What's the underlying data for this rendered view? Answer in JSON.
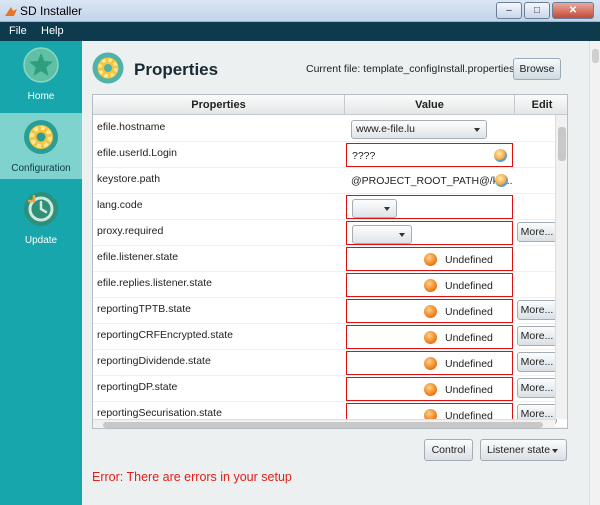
{
  "window": {
    "title": "SD Installer"
  },
  "menu": {
    "file": "File",
    "help": "Help"
  },
  "sidebar": {
    "items": [
      {
        "label": "Home",
        "icon": "star-icon",
        "active": false
      },
      {
        "label": "Configuration",
        "icon": "gear-icon",
        "active": true
      },
      {
        "label": "Update",
        "icon": "clock-refresh-icon",
        "active": false
      }
    ]
  },
  "header": {
    "title": "Properties",
    "current_file": "Current file: template_configInstall.properties",
    "browse_label": "Browse"
  },
  "table": {
    "columns": [
      "Properties",
      "Value",
      "Edit"
    ],
    "rows": [
      {
        "property": "efile.hostname",
        "value": "www.e-file.lu",
        "kind": "combo",
        "error": false,
        "edit": ""
      },
      {
        "property": "efile.userId.Login",
        "value": "????",
        "kind": "text",
        "error": true,
        "edit": ""
      },
      {
        "property": "keystore.path",
        "value": "@PROJECT_ROOT_PATH@/ke...",
        "kind": "text",
        "error": false,
        "edit": ""
      },
      {
        "property": "lang.code",
        "value": "",
        "kind": "combo",
        "error": true,
        "edit": ""
      },
      {
        "property": "proxy.required",
        "value": "",
        "kind": "combo",
        "error": true,
        "edit": "More..."
      },
      {
        "property": "efile.listener.state",
        "value": "Undefined",
        "kind": "state",
        "error": true,
        "edit": ""
      },
      {
        "property": "efile.replies.listener.state",
        "value": "Undefined",
        "kind": "state",
        "error": true,
        "edit": ""
      },
      {
        "property": "reportingTPTB.state",
        "value": "Undefined",
        "kind": "state",
        "error": true,
        "edit": "More..."
      },
      {
        "property": "reportingCRFEncrypted.state",
        "value": "Undefined",
        "kind": "state",
        "error": true,
        "edit": "More..."
      },
      {
        "property": "reportingDividende.state",
        "value": "Undefined",
        "kind": "state",
        "error": true,
        "edit": "More..."
      },
      {
        "property": "reportingDP.state",
        "value": "Undefined",
        "kind": "state",
        "error": true,
        "edit": "More..."
      },
      {
        "property": "reportingSecurisation.state",
        "value": "Undefined",
        "kind": "state",
        "error": true,
        "edit": "More..."
      }
    ]
  },
  "footer": {
    "control_label": "Control",
    "listener_label": "Listener state",
    "error_message": "Error: There are errors in your setup"
  },
  "colors": {
    "sidebar_bg": "#18a6ad",
    "sidebar_active_bg": "#7fd3cf",
    "menubar_bg": "#0d3a4c",
    "error_red": "#e0201b",
    "state_orange": "#ef7a17"
  }
}
